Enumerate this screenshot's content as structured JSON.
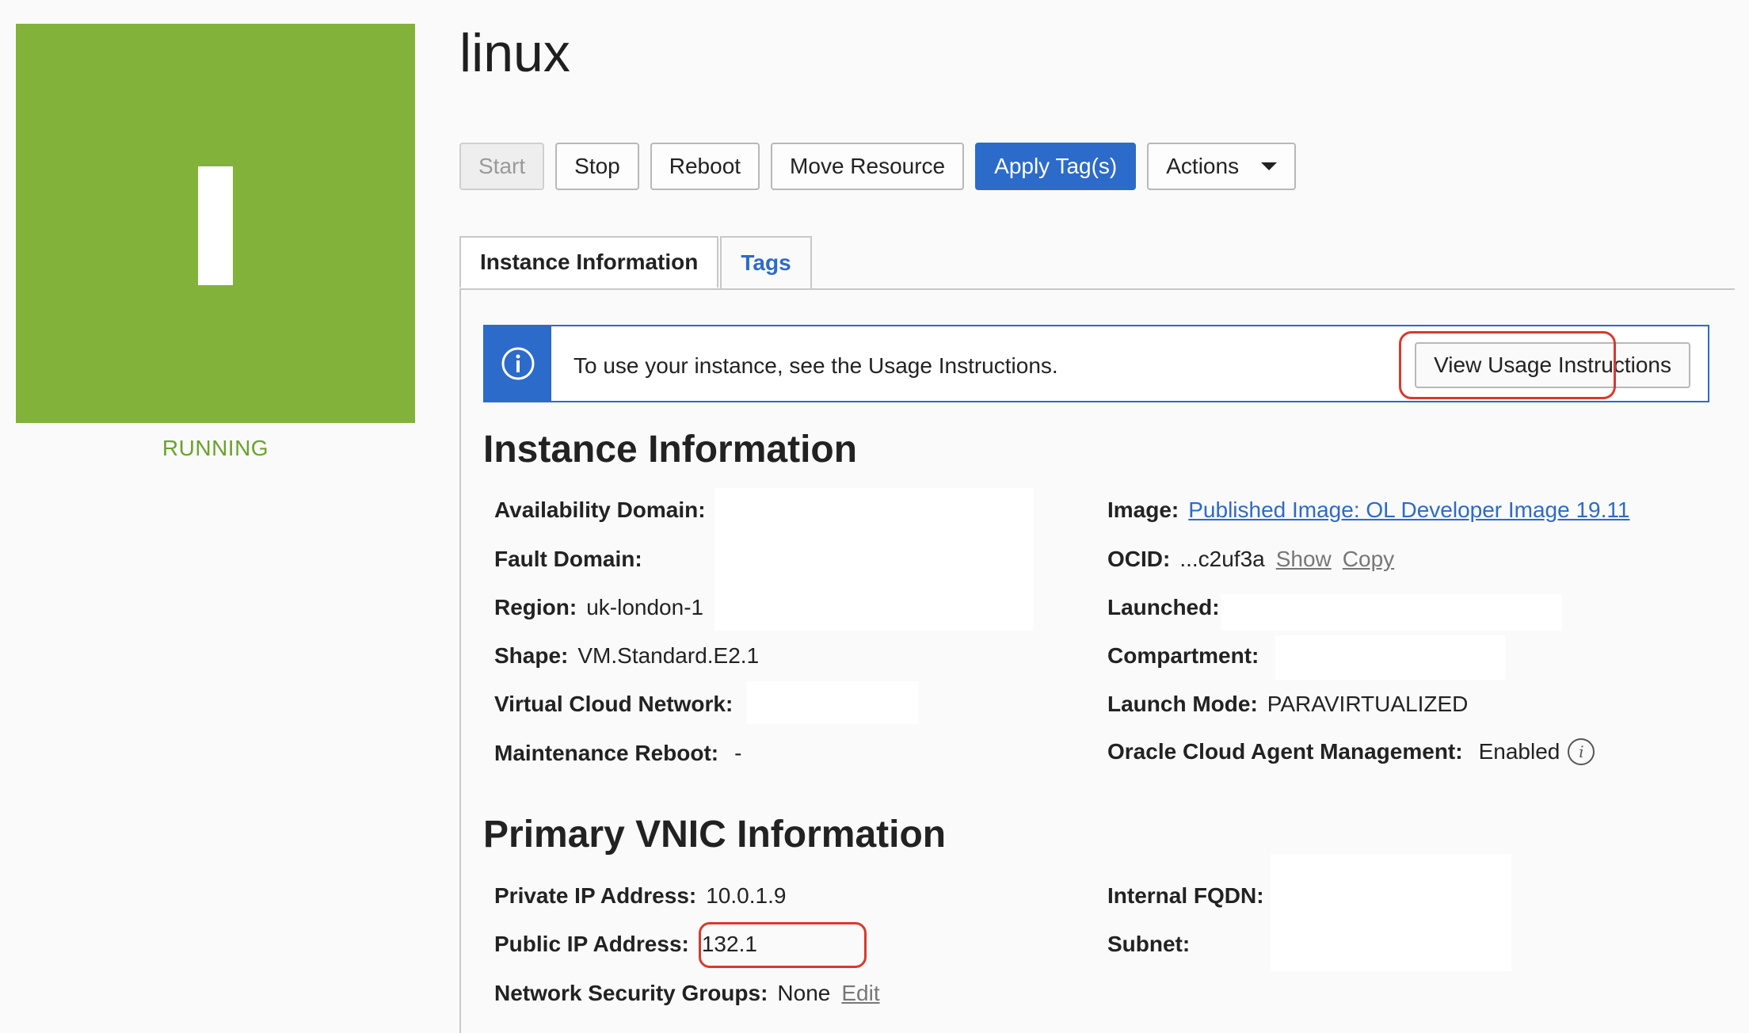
{
  "instance": {
    "avatar_letter": "I",
    "status": "RUNNING",
    "name": "linux"
  },
  "toolbar": {
    "start": "Start",
    "stop": "Stop",
    "reboot": "Reboot",
    "move": "Move Resource",
    "apply_tags": "Apply Tag(s)",
    "actions": "Actions"
  },
  "tabs": {
    "instance_information": "Instance Information",
    "tags": "Tags"
  },
  "banner": {
    "text": "To use your instance, see the Usage Instructions.",
    "button": "View Usage Instructions"
  },
  "instance_info": {
    "title": "Instance Information",
    "availability_domain": {
      "label": "Availability Domain:"
    },
    "fault_domain": {
      "label": "Fault Domain:"
    },
    "region": {
      "label": "Region:",
      "value": "uk-london-1"
    },
    "shape": {
      "label": "Shape:",
      "value": "VM.Standard.E2.1"
    },
    "vcn": {
      "label": "Virtual Cloud Network:"
    },
    "maintenance_reboot": {
      "label": "Maintenance Reboot:",
      "value": "-"
    },
    "image": {
      "label": "Image:",
      "value": "Published Image: OL Developer Image 19.11"
    },
    "ocid": {
      "label": "OCID:",
      "value": "...c2uf3a",
      "show": "Show",
      "copy": "Copy"
    },
    "launched": {
      "label": "Launched:"
    },
    "compartment": {
      "label": "Compartment:"
    },
    "launch_mode": {
      "label": "Launch Mode:",
      "value": "PARAVIRTUALIZED"
    },
    "agent": {
      "label": "Oracle Cloud Agent Management:",
      "value": "Enabled"
    }
  },
  "vnic": {
    "title": "Primary VNIC Information",
    "private_ip": {
      "label": "Private IP Address:",
      "value": "10.0.1.9"
    },
    "public_ip": {
      "label": "Public IP Address:",
      "value": "132.1"
    },
    "nsg": {
      "label": "Network Security Groups:",
      "value": "None",
      "edit": "Edit"
    },
    "fqdn": {
      "label": "Internal FQDN:"
    },
    "subnet": {
      "label": "Subnet:"
    }
  },
  "colors": {
    "tile": "#82b23a",
    "status": "#6aa32d",
    "primary": "#2c6bc9",
    "highlight": "#d9392e"
  }
}
